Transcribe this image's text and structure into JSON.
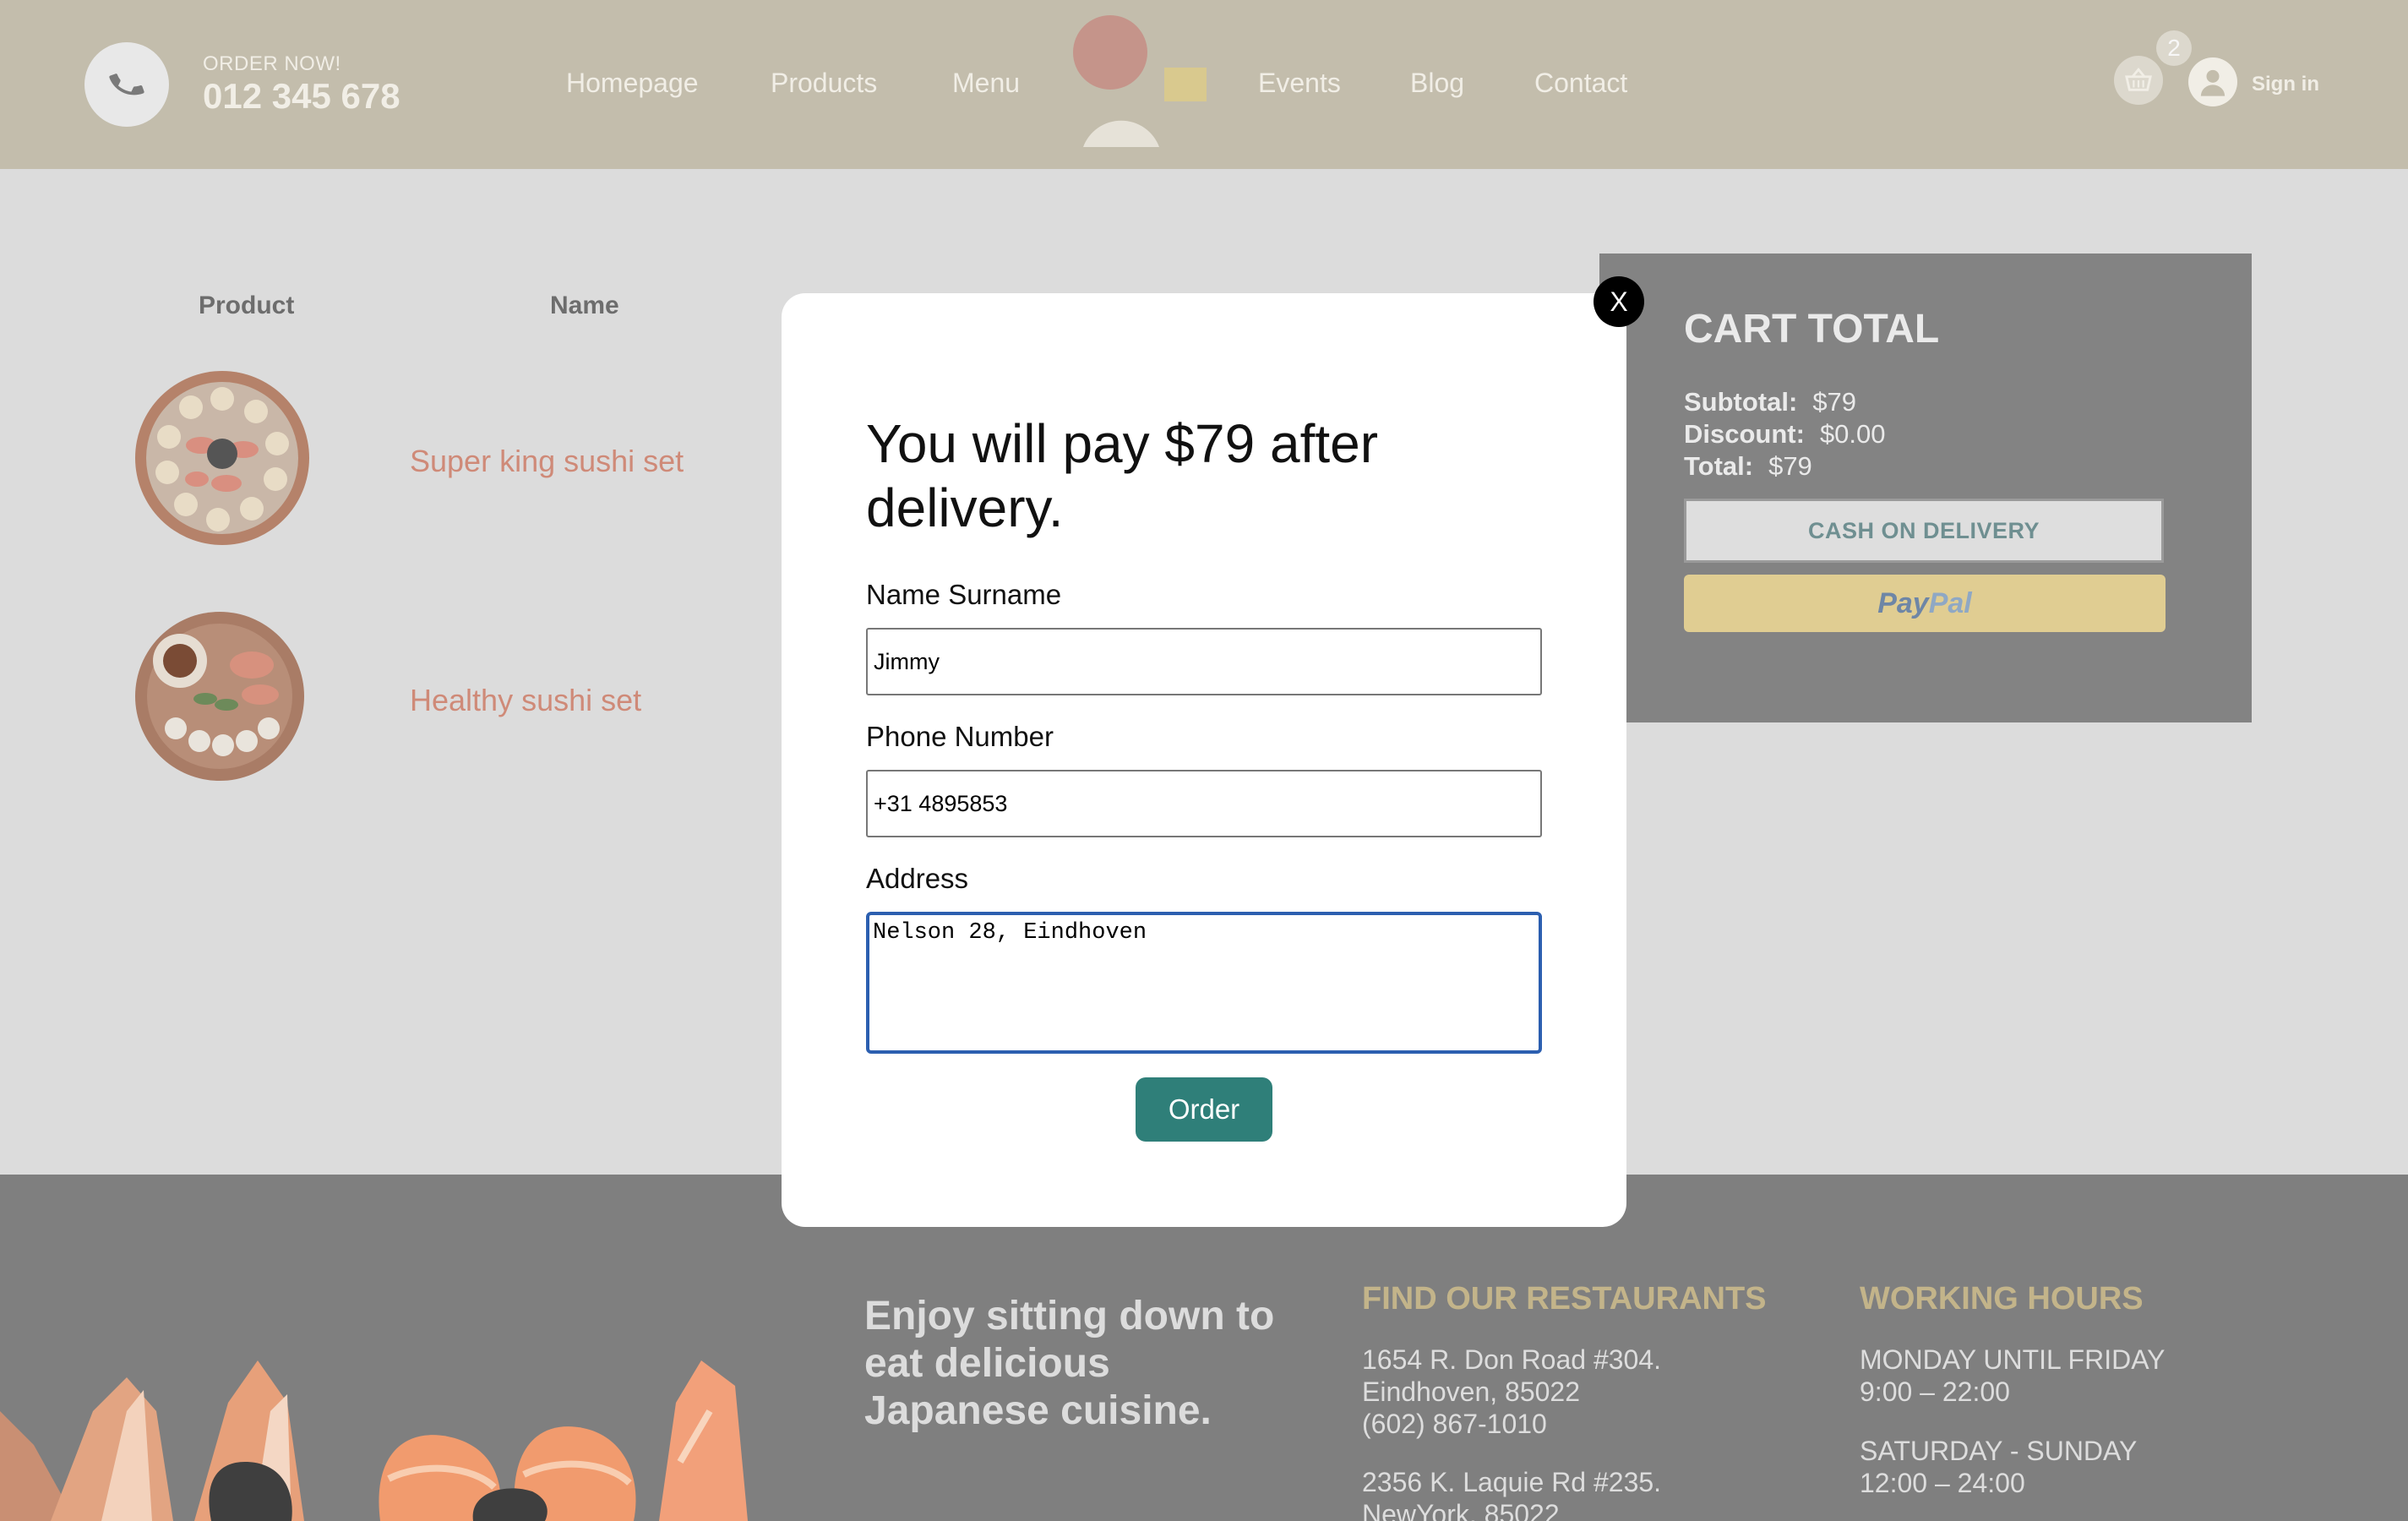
{
  "header": {
    "order_label": "ORDER NOW!",
    "phone": "012 345 678",
    "nav": [
      "Homepage",
      "Products",
      "Menu",
      "Events",
      "Blog",
      "Contact"
    ],
    "cart_count": "2",
    "sign_in": "Sign in",
    "colors": {
      "background": "#c3bdac",
      "text": "#f1eee6"
    }
  },
  "table": {
    "headers": {
      "product": "Product",
      "name": "Name"
    },
    "rows": [
      {
        "name": "Super king sushi set"
      },
      {
        "name": "Healthy sushi set"
      }
    ]
  },
  "cart_total": {
    "title": "CART TOTAL",
    "subtotal_label": "Subtotal:",
    "subtotal": "$79",
    "discount_label": "Discount:",
    "discount": "$0.00",
    "total_label": "Total:",
    "total": "$79",
    "cod_label": "CASH ON DELIVERY",
    "paypal_part1": "Pay",
    "paypal_part2": "Pal"
  },
  "modal": {
    "close": "X",
    "title": "You will pay $79 after delivery.",
    "name_label": "Name Surname",
    "name_value": "Jimmy",
    "phone_label": "Phone Number",
    "phone_value": "+31 4895853",
    "address_label": "Address",
    "address_value": "Nelson 28, Eindhoven",
    "order_button": "Order",
    "colors": {
      "order_button": "#2f7f79",
      "focus_border": "#2c5fb0"
    }
  },
  "footer": {
    "tagline": "Enjoy sitting down to eat delicious Japanese cuisine.",
    "restaurants_title": "FIND OUR RESTAURANTS",
    "restaurant1": [
      "1654 R. Don Road #304.",
      "Eindhoven, 85022",
      "(602) 867-1010"
    ],
    "restaurant2": [
      "2356 K. Laquie Rd #235.",
      "NewYork, 85022"
    ],
    "hours_title": "WORKING HOURS",
    "hours1": [
      "MONDAY UNTIL FRIDAY",
      "9:00 – 22:00"
    ],
    "hours2": [
      "SATURDAY - SUNDAY",
      "12:00 – 24:00"
    ],
    "colors": {
      "heading": "#c3b48a"
    }
  }
}
